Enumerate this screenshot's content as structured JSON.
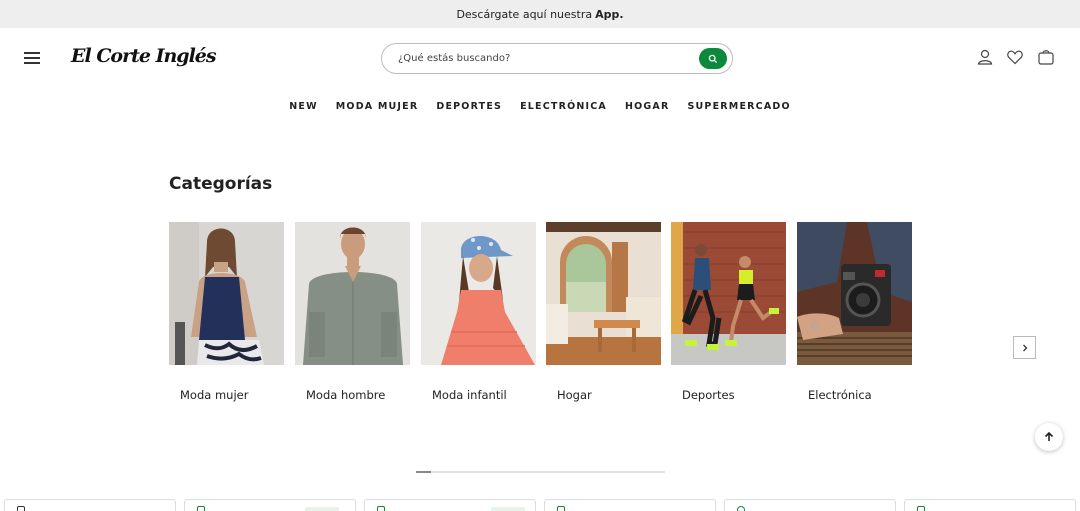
{
  "promo_bar": {
    "text": "Descárgate aquí nuestra",
    "bold": "App."
  },
  "header": {
    "logo_text": "El Corte Inglés",
    "search_placeholder": "¿Qué estás buscando?",
    "icons": [
      "user-icon",
      "heart-icon",
      "bag-icon"
    ],
    "accent": "#0a8a3a"
  },
  "nav": {
    "items": [
      {
        "label": "NEW"
      },
      {
        "label": "MODA MUJER"
      },
      {
        "label": "DEPORTES"
      },
      {
        "label": "ELECTRÓNICA"
      },
      {
        "label": "HOGAR"
      },
      {
        "label": "SUPERMERCADO"
      }
    ]
  },
  "categories": {
    "title": "Categorías",
    "items": [
      {
        "label": "Moda mujer"
      },
      {
        "label": "Moda hombre"
      },
      {
        "label": "Moda infantil"
      },
      {
        "label": "Hogar"
      },
      {
        "label": "Deportes"
      },
      {
        "label": "Electrónica"
      }
    ],
    "carousel_progress": 0.06
  }
}
